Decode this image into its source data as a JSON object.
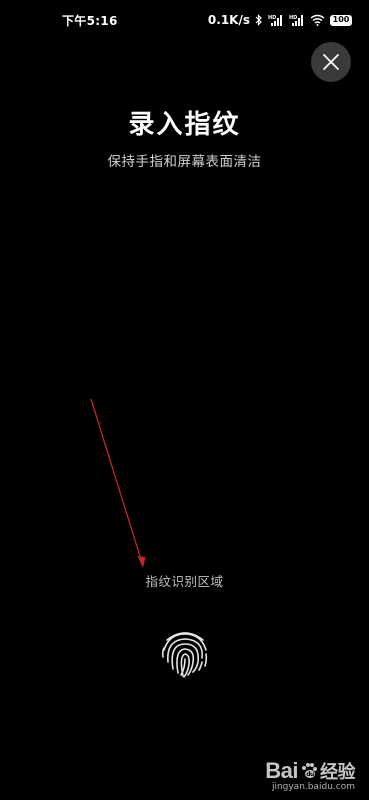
{
  "status_bar": {
    "time": "下午5:16",
    "network_speed": "0.1K/s",
    "battery_level": "100",
    "icons": [
      "bluetooth-icon",
      "signal-hd-icon",
      "signal-hd-icon",
      "wifi-icon",
      "battery-icon"
    ]
  },
  "header": {
    "close_icon": "close-icon"
  },
  "main": {
    "title": "录入指纹",
    "subtitle": "保持手指和屏幕表面清洁",
    "sensor_label": "指纹识别区域",
    "sensor_icon": "fingerprint-icon"
  },
  "annotation": {
    "arrow_color": "#c0262c"
  },
  "watermark": {
    "brand": "Bai",
    "brand_suffix": "经验",
    "site": "jingyan.baidu.com"
  },
  "colors": {
    "background": "#000000",
    "close_button_bg": "#3a3a3a",
    "text_primary": "#ffffff",
    "text_secondary": "#cfcfcf"
  }
}
